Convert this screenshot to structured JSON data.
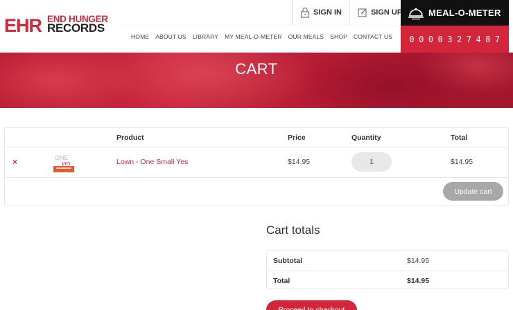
{
  "brand": {
    "mark": "EHR",
    "line1": "END HUNGER",
    "line2": "RECORDS",
    "accent": "#d3263b"
  },
  "top_links": {
    "sign_in": "SIGN IN",
    "sign_up": "SIGN UP"
  },
  "nav": [
    "HOME",
    "ABOUT US",
    "LIBRARY",
    "MY MEAL-O-METER",
    "OUR MEALS",
    "SHOP",
    "CONTACT US"
  ],
  "meter": {
    "title": "MEAL-O-METER",
    "count": "0000327487"
  },
  "page_title": "CART",
  "cart": {
    "headers": {
      "product": "Product",
      "price": "Price",
      "quantity": "Quantity",
      "total": "Total"
    },
    "item": {
      "remove": "×",
      "name": "Lown - One Small Yes",
      "price": "$14.95",
      "quantity": "1",
      "total": "$14.95",
      "thumb_text_1": "ONE",
      "thumb_text_2": "yes"
    },
    "update_label": "Update cart"
  },
  "totals": {
    "title": "Cart totals",
    "subtotal_label": "Subtotal",
    "subtotal_value": "$14.95",
    "total_label": "Total",
    "total_value": "$14.95"
  },
  "checkout_label": "Proceed to checkout"
}
